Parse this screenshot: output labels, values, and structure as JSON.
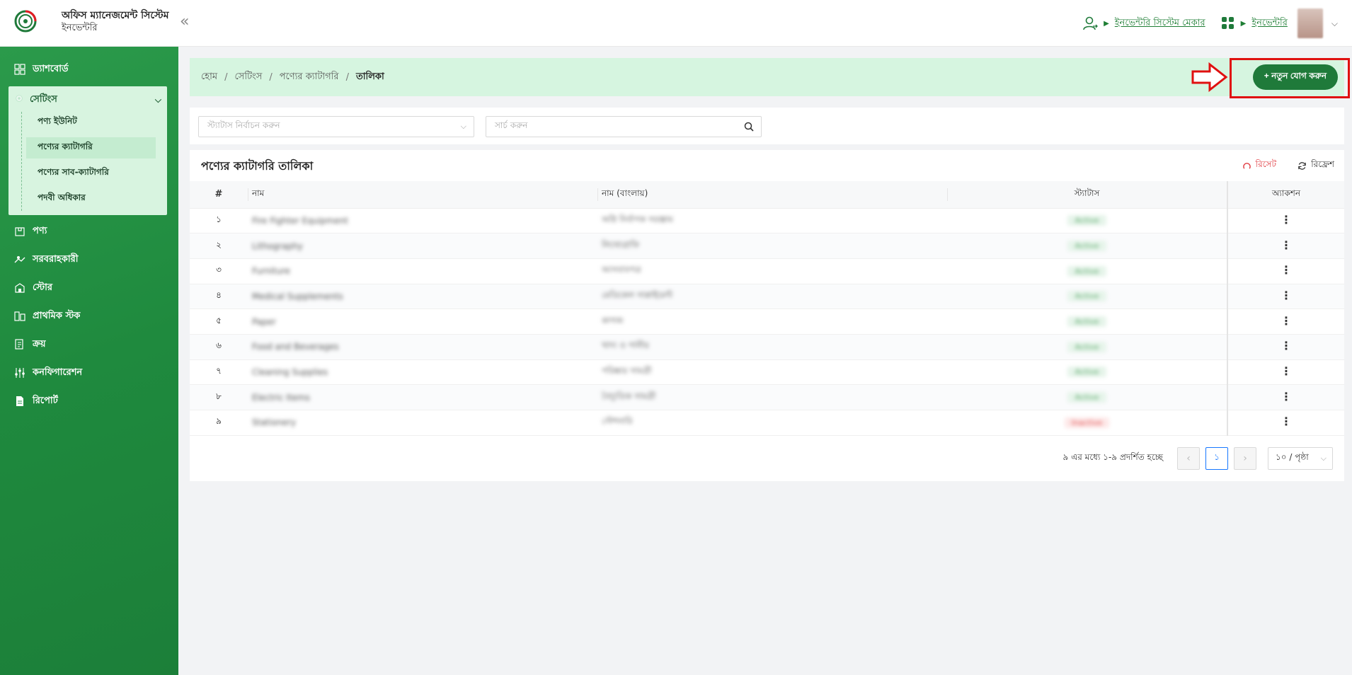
{
  "header": {
    "app_title": "অফিস ম্যানেজমেন্ট সিস্টেম",
    "app_subtitle": "ইনভেন্টরি",
    "collapse_label": "«",
    "role_link": "ইনভেন্টরি সিস্টেম মেকার",
    "module_link": "ইনভেন্টরি"
  },
  "sidebar": {
    "items": [
      {
        "label": "ড্যাশবোর্ড",
        "icon": "dashboard-icon"
      },
      {
        "label": "সেটিংস",
        "icon": "settings-icon"
      },
      {
        "label": "পণ্য",
        "icon": "product-icon"
      },
      {
        "label": "সরবরাহকারী",
        "icon": "supplier-icon"
      },
      {
        "label": "স্টোর",
        "icon": "store-icon"
      },
      {
        "label": "প্রাথমিক স্টক",
        "icon": "stock-icon"
      },
      {
        "label": "ক্রয়",
        "icon": "purchase-icon"
      },
      {
        "label": "কনফিগারেশন",
        "icon": "config-icon"
      },
      {
        "label": "রিপোর্ট",
        "icon": "report-icon"
      }
    ],
    "settings_sub": [
      {
        "label": "পণ্য ইউনিট"
      },
      {
        "label": "পণ্যের ক্যাটাগরি"
      },
      {
        "label": "পণ্যের সাব-ক্যাটাগরি"
      },
      {
        "label": "পদবী অধিকার"
      }
    ]
  },
  "breadcrumb": {
    "home": "হোম",
    "settings": "সেটিংস",
    "category": "পণ্যের ক্যাটাগরি",
    "current": "তালিকা",
    "separator": "/"
  },
  "add_button": "+ নতুন যোগ করুন",
  "filters": {
    "status_placeholder": "স্ট্যাটাস নির্বাচন করুন",
    "search_placeholder": "সার্চ করুন"
  },
  "table": {
    "title": "পণ্যের ক্যাটাগরি তালিকা",
    "reset_label": "রিসেট",
    "refresh_label": "রিফ্রেশ",
    "columns": {
      "num": "#",
      "name": "নাম",
      "name_bn": "নাম (বাংলায়)",
      "status": "স্ট্যাটাস",
      "action": "অ্যাকশন"
    },
    "rows": [
      {
        "num": "১",
        "name": "Fire Fighter Equipment",
        "name_bn": "অগ্নি নির্বাপক সরঞ্জাম",
        "status": "Active",
        "active": true
      },
      {
        "num": "২",
        "name": "Lithography",
        "name_bn": "লিথোগ্রাফি",
        "status": "Active",
        "active": true
      },
      {
        "num": "৩",
        "name": "Furniture",
        "name_bn": "আসবাবপত্র",
        "status": "Active",
        "active": true
      },
      {
        "num": "৪",
        "name": "Medical Supplements",
        "name_bn": "মেডিকেল সাপ্লাইমেন্ট",
        "status": "Active",
        "active": true
      },
      {
        "num": "৫",
        "name": "Paper",
        "name_bn": "কাগজ",
        "status": "Active",
        "active": true
      },
      {
        "num": "৬",
        "name": "Food and Beverages",
        "name_bn": "খাদ্য ও পানীয়",
        "status": "Active",
        "active": true
      },
      {
        "num": "৭",
        "name": "Cleaning Supplies",
        "name_bn": "পরিষ্কার সামগ্রী",
        "status": "Active",
        "active": true
      },
      {
        "num": "৮",
        "name": "Electric Items",
        "name_bn": "বৈদ্যুতিক সামগ্রী",
        "status": "Active",
        "active": true
      },
      {
        "num": "৯",
        "name": "Stationery",
        "name_bn": "স্টেশনারি",
        "status": "Inactive",
        "active": false
      }
    ]
  },
  "pagination": {
    "summary": "৯ এর মধ্যে ১-৯ প্রদর্শিত হচ্ছে",
    "prev": "‹",
    "current_page": "১",
    "next": "›",
    "page_size": "১০ / পৃষ্ঠা"
  },
  "colors": {
    "brand_green": "#1f7a3a",
    "sidebar_green": "#229144",
    "highlight_red": "#e01010",
    "reset_red": "#e0383e"
  }
}
